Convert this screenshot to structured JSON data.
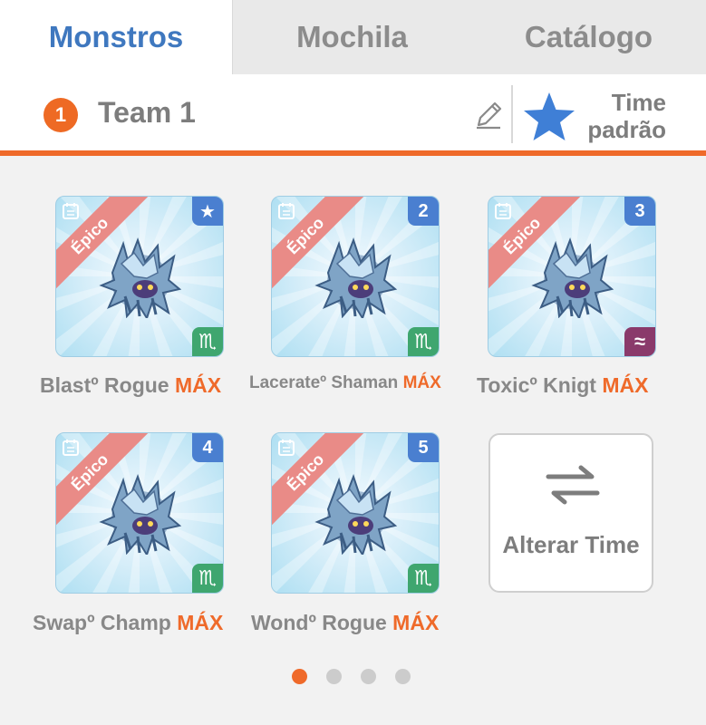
{
  "tabs": [
    {
      "label": "Monstros",
      "active": true
    },
    {
      "label": "Mochila",
      "active": false
    },
    {
      "label": "Catálogo",
      "active": false
    }
  ],
  "team": {
    "number": "1",
    "name": "Team 1",
    "default_label_line1": "Time",
    "default_label_line2": "padrão"
  },
  "monsters": [
    {
      "rarity": "Épico",
      "slot": "★",
      "element": "♏",
      "element_color": "green",
      "name": "Blastº Rogue",
      "level": "MÁX"
    },
    {
      "rarity": "Épico",
      "slot": "2",
      "element": "♏",
      "element_color": "green",
      "name": "Lacerateº Shaman",
      "level": "MÁX"
    },
    {
      "rarity": "Épico",
      "slot": "3",
      "element": "≈",
      "element_color": "purple",
      "name": "Toxicº Knigt",
      "level": "MÁX"
    },
    {
      "rarity": "Épico",
      "slot": "4",
      "element": "♏",
      "element_color": "green",
      "name": "Swapº Champ",
      "level": "MÁX"
    },
    {
      "rarity": "Épico",
      "slot": "5",
      "element": "♏",
      "element_color": "green",
      "name": "Wondº Rogue",
      "level": "MÁX"
    }
  ],
  "swap_button": {
    "label": "Alterar Time"
  },
  "pagination": {
    "pages": 4,
    "current": 1
  },
  "colors": {
    "accent": "#ef6a2a",
    "tab_active": "#3f78bf",
    "star": "#3f7fd6"
  }
}
